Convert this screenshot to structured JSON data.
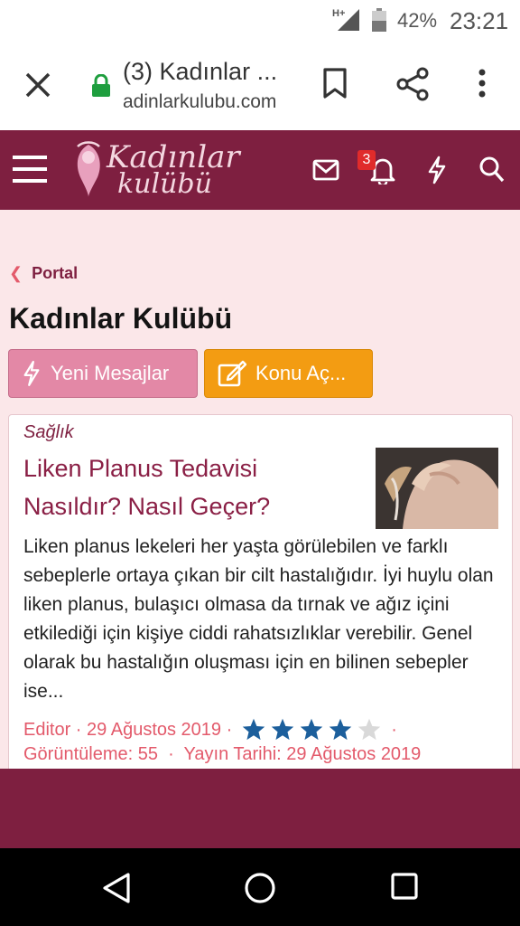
{
  "status": {
    "network": "H+",
    "battery": "42%",
    "time": "23:21"
  },
  "browser": {
    "tab_title": "(3) Kadınlar ...",
    "url": "adinlarkulubu.com"
  },
  "site": {
    "logo_line1": "Kadınlar",
    "logo_line2": "kulübü",
    "notification_count": "3",
    "brand_color": "#7e1f40"
  },
  "breadcrumb": {
    "label": "Portal"
  },
  "page": {
    "title": "Kadınlar Kulübü"
  },
  "actions": {
    "new_messages": "Yeni Mesajlar",
    "new_topic": "Konu Aç..."
  },
  "article": {
    "category": "Sağlık",
    "title": "Liken Planus Tedavisi Nasıldır? Nasıl Geçer?",
    "excerpt": "Liken planus lekeleri her yaşta görülebilen ve farklı sebeplerle ortaya çıkan bir cilt hastalığıdır. İyi huylu olan liken planus, bulaşıcı olmasa da tırnak ve ağız içini etkilediği için kişiye ciddi rahatsızlıklar verebilir. Genel olarak bu hastalığın oluşması için en bilinen sebepler ise...",
    "author": "Editor",
    "date": "29 Ağustos 2019",
    "rating": 4,
    "rating_max": 5,
    "views": "Görüntüleme: 55",
    "published": "Yayın Tarihi: 29 Ağustos 2019"
  }
}
